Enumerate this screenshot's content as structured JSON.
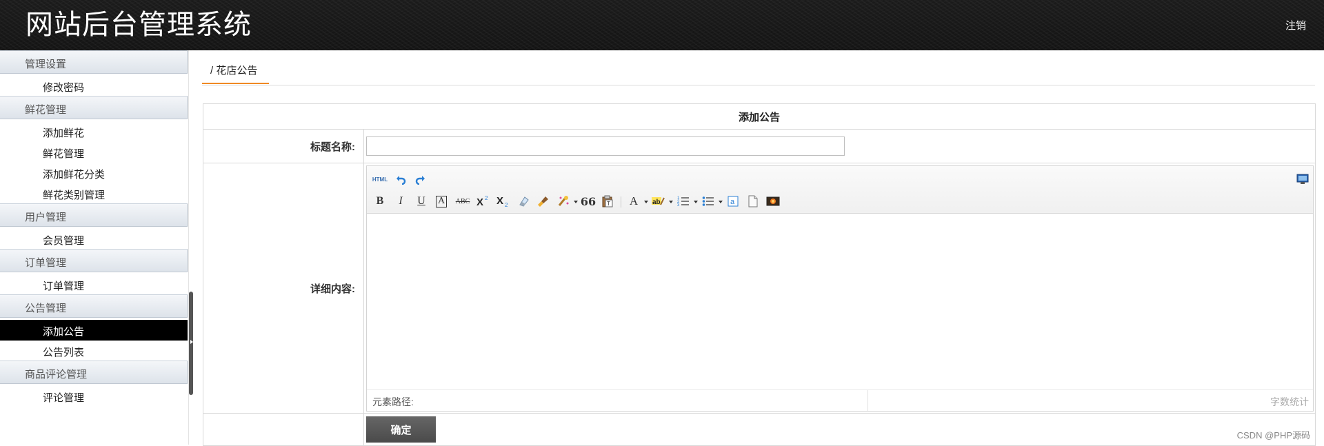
{
  "header": {
    "title": "网站后台管理系统",
    "logout_label": "注销"
  },
  "sidebar": {
    "groups": [
      {
        "title": "管理设置",
        "items": [
          {
            "label": "修改密码"
          }
        ]
      },
      {
        "title": "鲜花管理",
        "items": [
          {
            "label": "添加鲜花"
          },
          {
            "label": "鲜花管理"
          },
          {
            "label": "添加鲜花分类"
          },
          {
            "label": "鲜花类别管理"
          }
        ]
      },
      {
        "title": "用户管理",
        "items": [
          {
            "label": "会员管理"
          }
        ]
      },
      {
        "title": "订单管理",
        "items": [
          {
            "label": "订单管理"
          }
        ]
      },
      {
        "title": "公告管理",
        "items": [
          {
            "label": "添加公告",
            "active": true
          },
          {
            "label": "公告列表"
          }
        ]
      },
      {
        "title": "商品评论管理",
        "items": [
          {
            "label": "评论管理"
          }
        ]
      }
    ]
  },
  "breadcrumb": {
    "label": "/ 花店公告"
  },
  "form": {
    "caption": "添加公告",
    "title_label": "标题名称:",
    "title_value": "",
    "content_label": "详细内容:",
    "submit_label": "确定"
  },
  "editor": {
    "html_label": "HTML",
    "element_path_label": "元素路径:",
    "word_count_label": "字数统计",
    "toolbar_icons": [
      "undo-icon",
      "redo-icon",
      "fullscreen-icon",
      "bold-icon",
      "italic-icon",
      "underline-icon",
      "fontborder-icon",
      "strikethrough-icon",
      "superscript-icon",
      "subscript-icon",
      "removeformat-icon",
      "formatmatch-icon",
      "autotypeset-icon",
      "blockquote-icon",
      "pasteplain-icon",
      "forecolor-icon",
      "backcolor-icon",
      "insertorderedlist-icon",
      "insertunorderedlist-icon",
      "anchor-icon",
      "template-icon",
      "image-icon"
    ],
    "text_glyphs": {
      "bold": "B",
      "italic": "I",
      "underline": "U",
      "fontborder": "A",
      "strikethrough": "ABC",
      "forecolor": "A",
      "quote": "66"
    }
  },
  "watermark": "CSDN @PHP源码",
  "colors": {
    "active_tab_underline": "#f08a24",
    "header_bg": "#161616",
    "active_menu_bg": "#000000"
  }
}
